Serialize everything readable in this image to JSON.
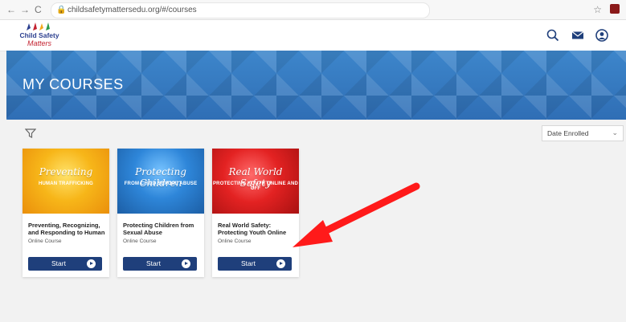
{
  "browser": {
    "url": "childsafetymattersedu.org/#/courses",
    "back": "←",
    "forward": "→",
    "reload": "C",
    "lock": "🔒",
    "star": "☆"
  },
  "header": {
    "logo_line1": "Child Safety",
    "logo_line2": "Matters"
  },
  "banner": {
    "title": "MY COURSES"
  },
  "sort": {
    "selected": "Date Enrolled",
    "chevron": "⌄"
  },
  "courses": [
    {
      "thumb_script": "Preventing",
      "thumb_caption": "HUMAN TRAFFICKING",
      "title": "Preventing, Recognizing, and Responding to Human",
      "type": "Online Course",
      "button": "Start"
    },
    {
      "thumb_script": "Protecting Children",
      "thumb_caption": "FROM CHILD SEXUAL ABUSE",
      "title": "Protecting Children from Sexual Abuse",
      "type": "Online Course",
      "button": "Start"
    },
    {
      "thumb_script": "Real World Safety",
      "thumb_caption": "PROTECTING YOUTH ONLINE AND OFF",
      "title": "Real World Safety: Protecting Youth Online",
      "type": "Online Course",
      "button": "Start"
    }
  ],
  "colors": {
    "brand_blue": "#1f3f7b",
    "arrow_red": "#ff1a1a"
  }
}
